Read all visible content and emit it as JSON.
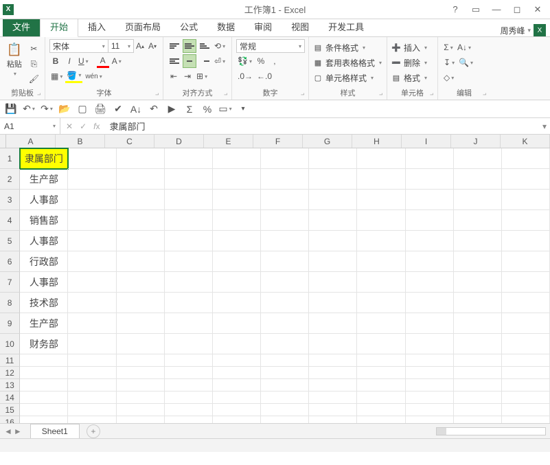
{
  "title": "工作簿1 - Excel",
  "user": "周秀峰",
  "tabs": {
    "file": "文件",
    "home": "开始",
    "insert": "插入",
    "layout": "页面布局",
    "formulas": "公式",
    "data": "数据",
    "review": "审阅",
    "view": "视图",
    "dev": "开发工具"
  },
  "groups": {
    "clipboard": "剪贴板",
    "paste": "粘贴",
    "font": "字体",
    "align": "对齐方式",
    "number": "数字",
    "styles": "样式",
    "cells": "单元格",
    "editing": "编辑"
  },
  "font": {
    "name": "宋体",
    "size": "11"
  },
  "number_format": "常规",
  "styles_menu": {
    "cond": "条件格式",
    "table": "套用表格格式",
    "cell": "单元格样式"
  },
  "cells_menu": {
    "insert": "插入",
    "delete": "删除",
    "format": "格式"
  },
  "namebox": "A1",
  "formula": "隶属部门",
  "columns": [
    "A",
    "B",
    "C",
    "D",
    "E",
    "F",
    "G",
    "H",
    "I",
    "J",
    "K"
  ],
  "rows": [
    {
      "n": "1",
      "a": "隶属部门",
      "header": true
    },
    {
      "n": "2",
      "a": "生产部"
    },
    {
      "n": "3",
      "a": "人事部"
    },
    {
      "n": "4",
      "a": "销售部"
    },
    {
      "n": "5",
      "a": "人事部"
    },
    {
      "n": "6",
      "a": "行政部"
    },
    {
      "n": "7",
      "a": "人事部"
    },
    {
      "n": "8",
      "a": "技术部"
    },
    {
      "n": "9",
      "a": "生产部"
    },
    {
      "n": "10",
      "a": "财务部"
    },
    {
      "n": "11",
      "a": ""
    },
    {
      "n": "12",
      "a": ""
    },
    {
      "n": "13",
      "a": ""
    },
    {
      "n": "14",
      "a": ""
    },
    {
      "n": "15",
      "a": ""
    },
    {
      "n": "16",
      "a": ""
    }
  ],
  "sheet": "Sheet1"
}
